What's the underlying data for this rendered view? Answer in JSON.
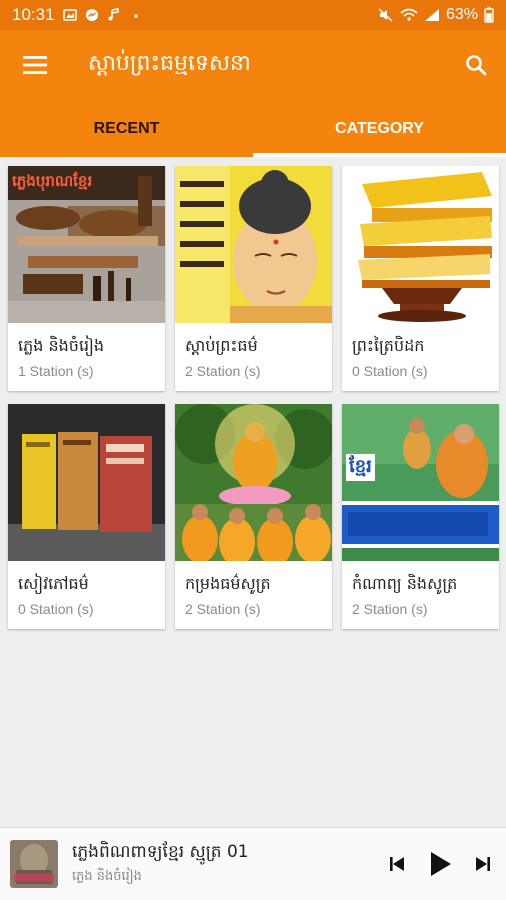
{
  "status": {
    "time": "10:31",
    "battery": "63%",
    "colors": {
      "bar": "#e8760a"
    }
  },
  "app": {
    "title": "ស្តាប់ព្រះធម្មទេសនា",
    "menu_icon": "hamburger-menu-icon",
    "search_icon": "search-icon",
    "accent": "#f5840f"
  },
  "tabs": [
    {
      "label": "RECENT",
      "selected": false
    },
    {
      "label": "CATEGORY",
      "selected": true
    }
  ],
  "categories": [
    {
      "title": "ភ្លេង និងចំរៀង",
      "count": "1 Station (s)",
      "thumb_caption": "ភ្លេងបុរាណខ្មែរ"
    },
    {
      "title": "ស្តាប់ព្រះធម៌",
      "count": "2 Station (s)",
      "thumb_caption": ""
    },
    {
      "title": "ព្រះត្រៃបិដក",
      "count": "0 Station (s)",
      "thumb_caption": ""
    },
    {
      "title": "សៀវភៅធម៌",
      "count": "0 Station (s)",
      "thumb_caption": ""
    },
    {
      "title": "កម្រងធម៌សូត្រ",
      "count": "2 Station (s)",
      "thumb_caption": ""
    },
    {
      "title": "កំណាព្យ និងសូត្រ",
      "count": "2 Station (s)",
      "thumb_caption": "ខ្មែរ"
    }
  ],
  "player": {
    "title": "ភ្លេងពិណពាទ្យខ្មែរ ស្មូត្រ 01",
    "subtitle": "ភ្លេង និងចំរៀង",
    "controls": [
      "skip-previous-icon",
      "play-icon",
      "skip-next-icon"
    ]
  }
}
